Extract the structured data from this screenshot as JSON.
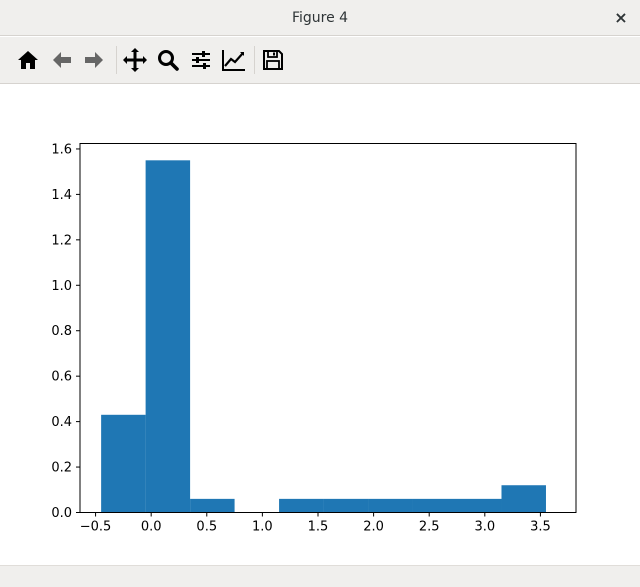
{
  "window": {
    "title": "Figure 4",
    "close_glyph": "×"
  },
  "toolbar": {
    "buttons": [
      {
        "name": "home-icon"
      },
      {
        "name": "back-arrow-icon"
      },
      {
        "name": "forward-arrow-icon"
      },
      {
        "name": "pan-move-icon"
      },
      {
        "name": "zoom-magnifier-icon"
      },
      {
        "name": "configure-subplots-icon"
      },
      {
        "name": "edit-axes-icon"
      },
      {
        "name": "save-floppy-icon"
      }
    ]
  },
  "colors": {
    "bar": "#1f77b4",
    "chrome": "#f0efed",
    "icon": "#000000"
  },
  "chart_data": {
    "type": "bar",
    "title": "",
    "xlabel": "",
    "ylabel": "",
    "xlim": [
      -0.64,
      3.82
    ],
    "ylim": [
      0.0,
      1.624
    ],
    "grid": false,
    "bins": [
      {
        "x0": -0.45,
        "x1": -0.05,
        "y": 0.43
      },
      {
        "x0": -0.05,
        "x1": 0.35,
        "y": 1.55
      },
      {
        "x0": 0.35,
        "x1": 0.75,
        "y": 0.06
      },
      {
        "x0": 0.75,
        "x1": 1.15,
        "y": 0.0
      },
      {
        "x0": 1.15,
        "x1": 1.55,
        "y": 0.06
      },
      {
        "x0": 1.55,
        "x1": 1.95,
        "y": 0.06
      },
      {
        "x0": 1.95,
        "x1": 2.35,
        "y": 0.06
      },
      {
        "x0": 2.35,
        "x1": 2.75,
        "y": 0.06
      },
      {
        "x0": 2.75,
        "x1": 3.15,
        "y": 0.06
      },
      {
        "x0": 3.15,
        "x1": 3.55,
        "y": 0.12
      }
    ],
    "xticks": [
      {
        "value": -0.5,
        "label": "−0.5"
      },
      {
        "value": 0.0,
        "label": "0.0"
      },
      {
        "value": 0.5,
        "label": "0.5"
      },
      {
        "value": 1.0,
        "label": "1.0"
      },
      {
        "value": 1.5,
        "label": "1.5"
      },
      {
        "value": 2.0,
        "label": "2.0"
      },
      {
        "value": 2.5,
        "label": "2.5"
      },
      {
        "value": 3.0,
        "label": "3.0"
      },
      {
        "value": 3.5,
        "label": "3.5"
      }
    ],
    "yticks": [
      {
        "value": 0.0,
        "label": "0.0"
      },
      {
        "value": 0.2,
        "label": "0.2"
      },
      {
        "value": 0.4,
        "label": "0.4"
      },
      {
        "value": 0.6,
        "label": "0.6"
      },
      {
        "value": 0.8,
        "label": "0.8"
      },
      {
        "value": 1.0,
        "label": "1.0"
      },
      {
        "value": 1.2,
        "label": "1.2"
      },
      {
        "value": 1.4,
        "label": "1.4"
      },
      {
        "value": 1.6,
        "label": "1.6"
      }
    ]
  }
}
